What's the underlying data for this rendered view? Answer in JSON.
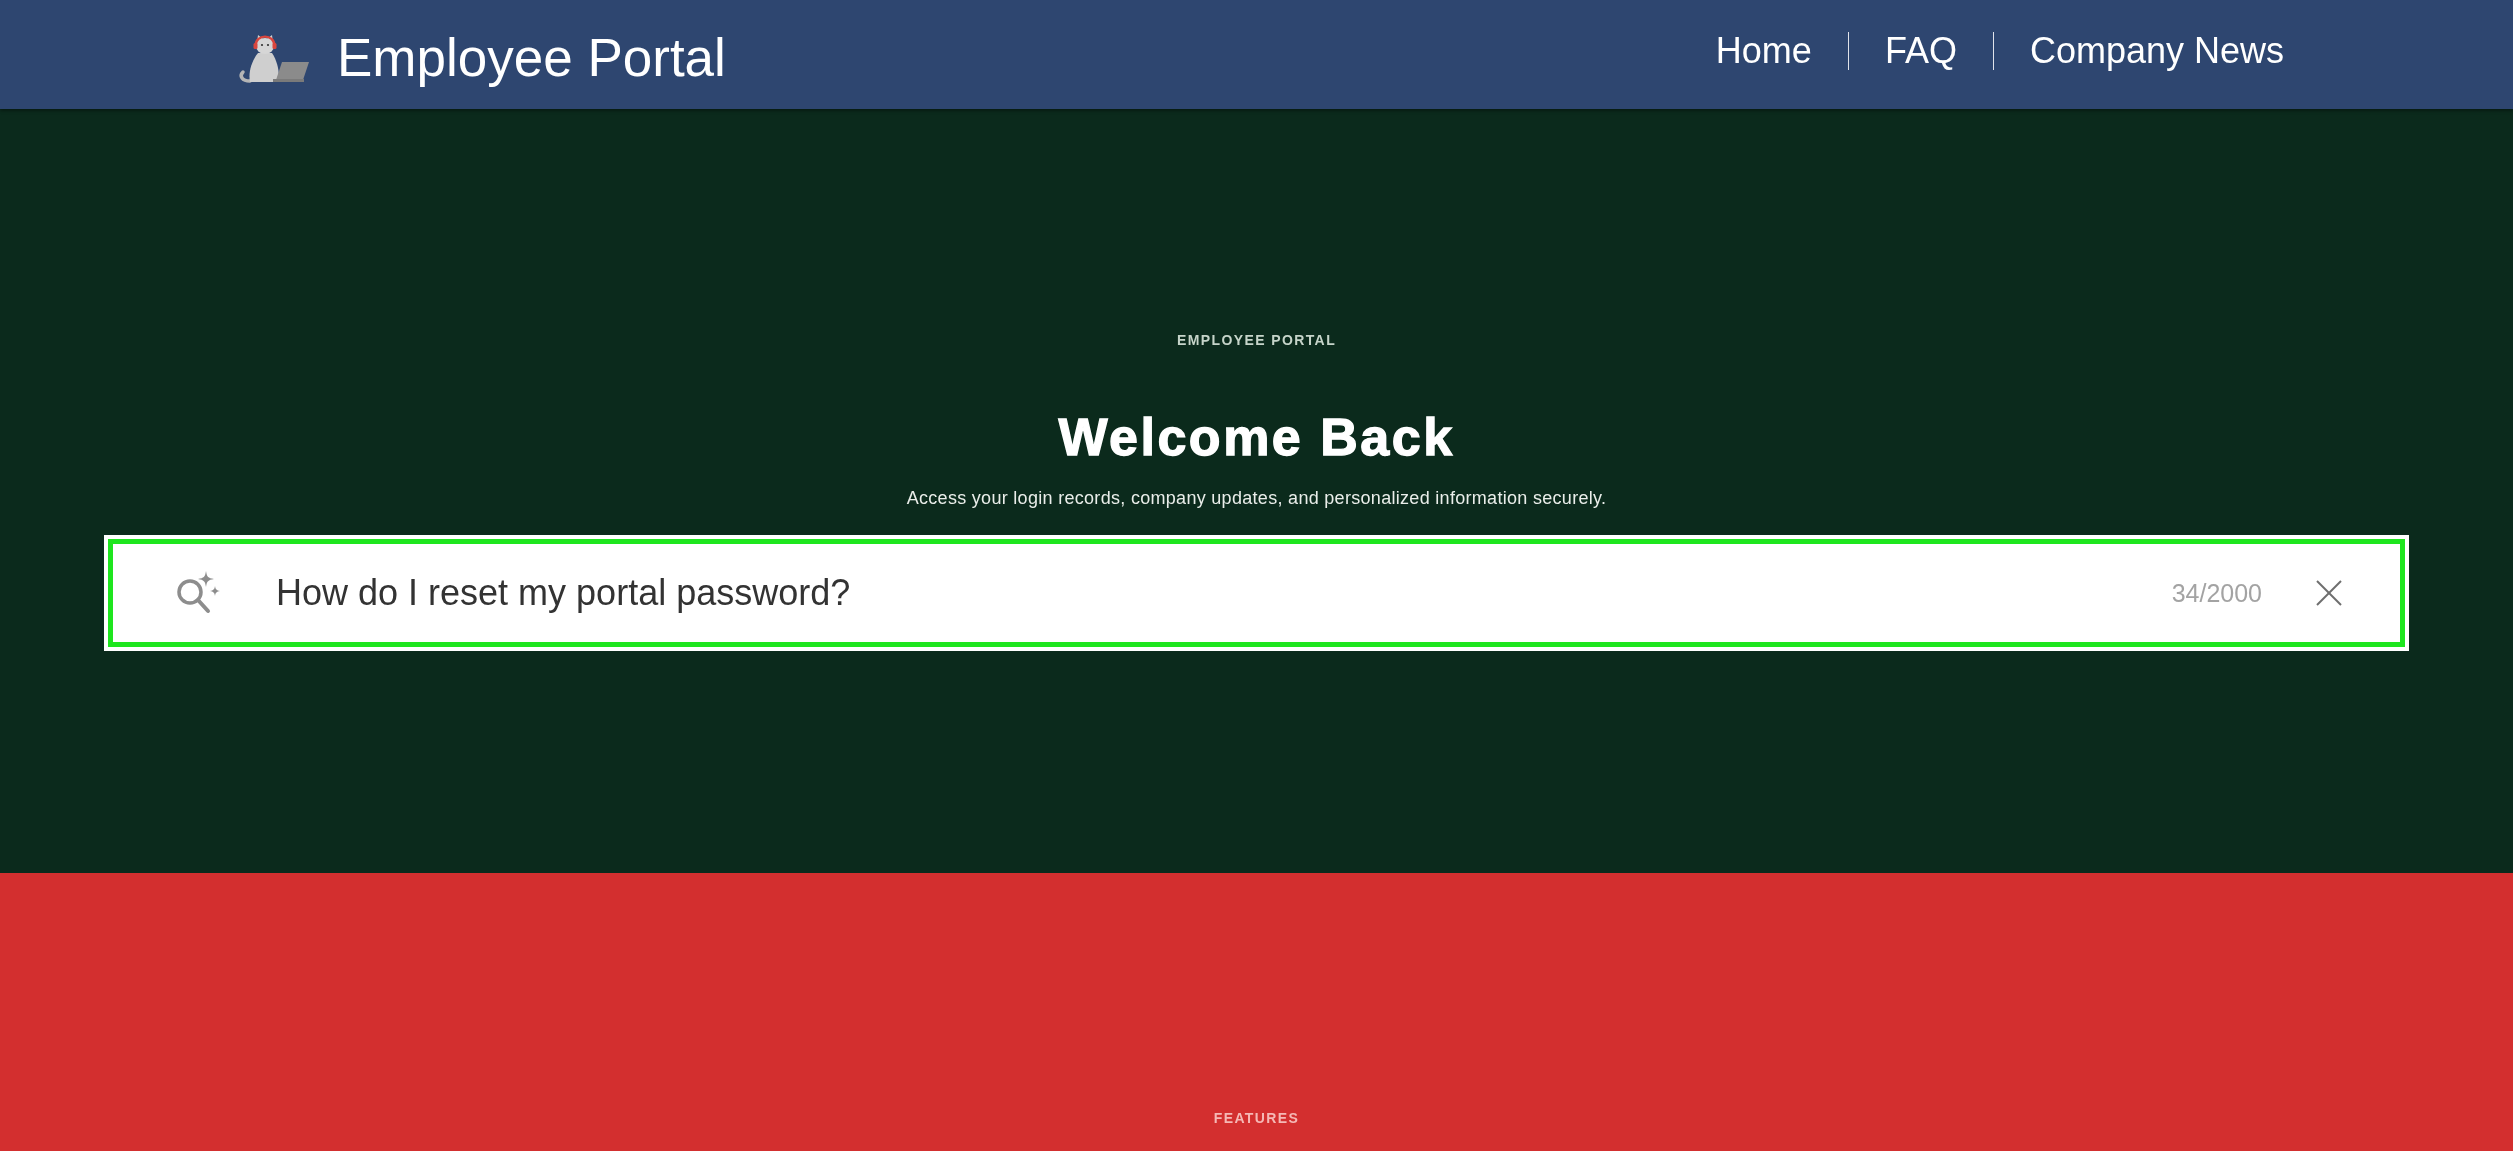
{
  "header": {
    "logo_title": "Employee Portal",
    "nav": [
      "Home",
      "FAQ",
      "Company News"
    ]
  },
  "hero": {
    "eyebrow": "EMPLOYEE PORTAL",
    "title": "Welcome Back",
    "subtitle": "Access your login records, company updates, and personalized information securely.",
    "search": {
      "value": "How do I reset my portal password?",
      "counter": "34/2000",
      "focused": true
    }
  },
  "features": {
    "eyebrow": "FEATURES"
  }
}
